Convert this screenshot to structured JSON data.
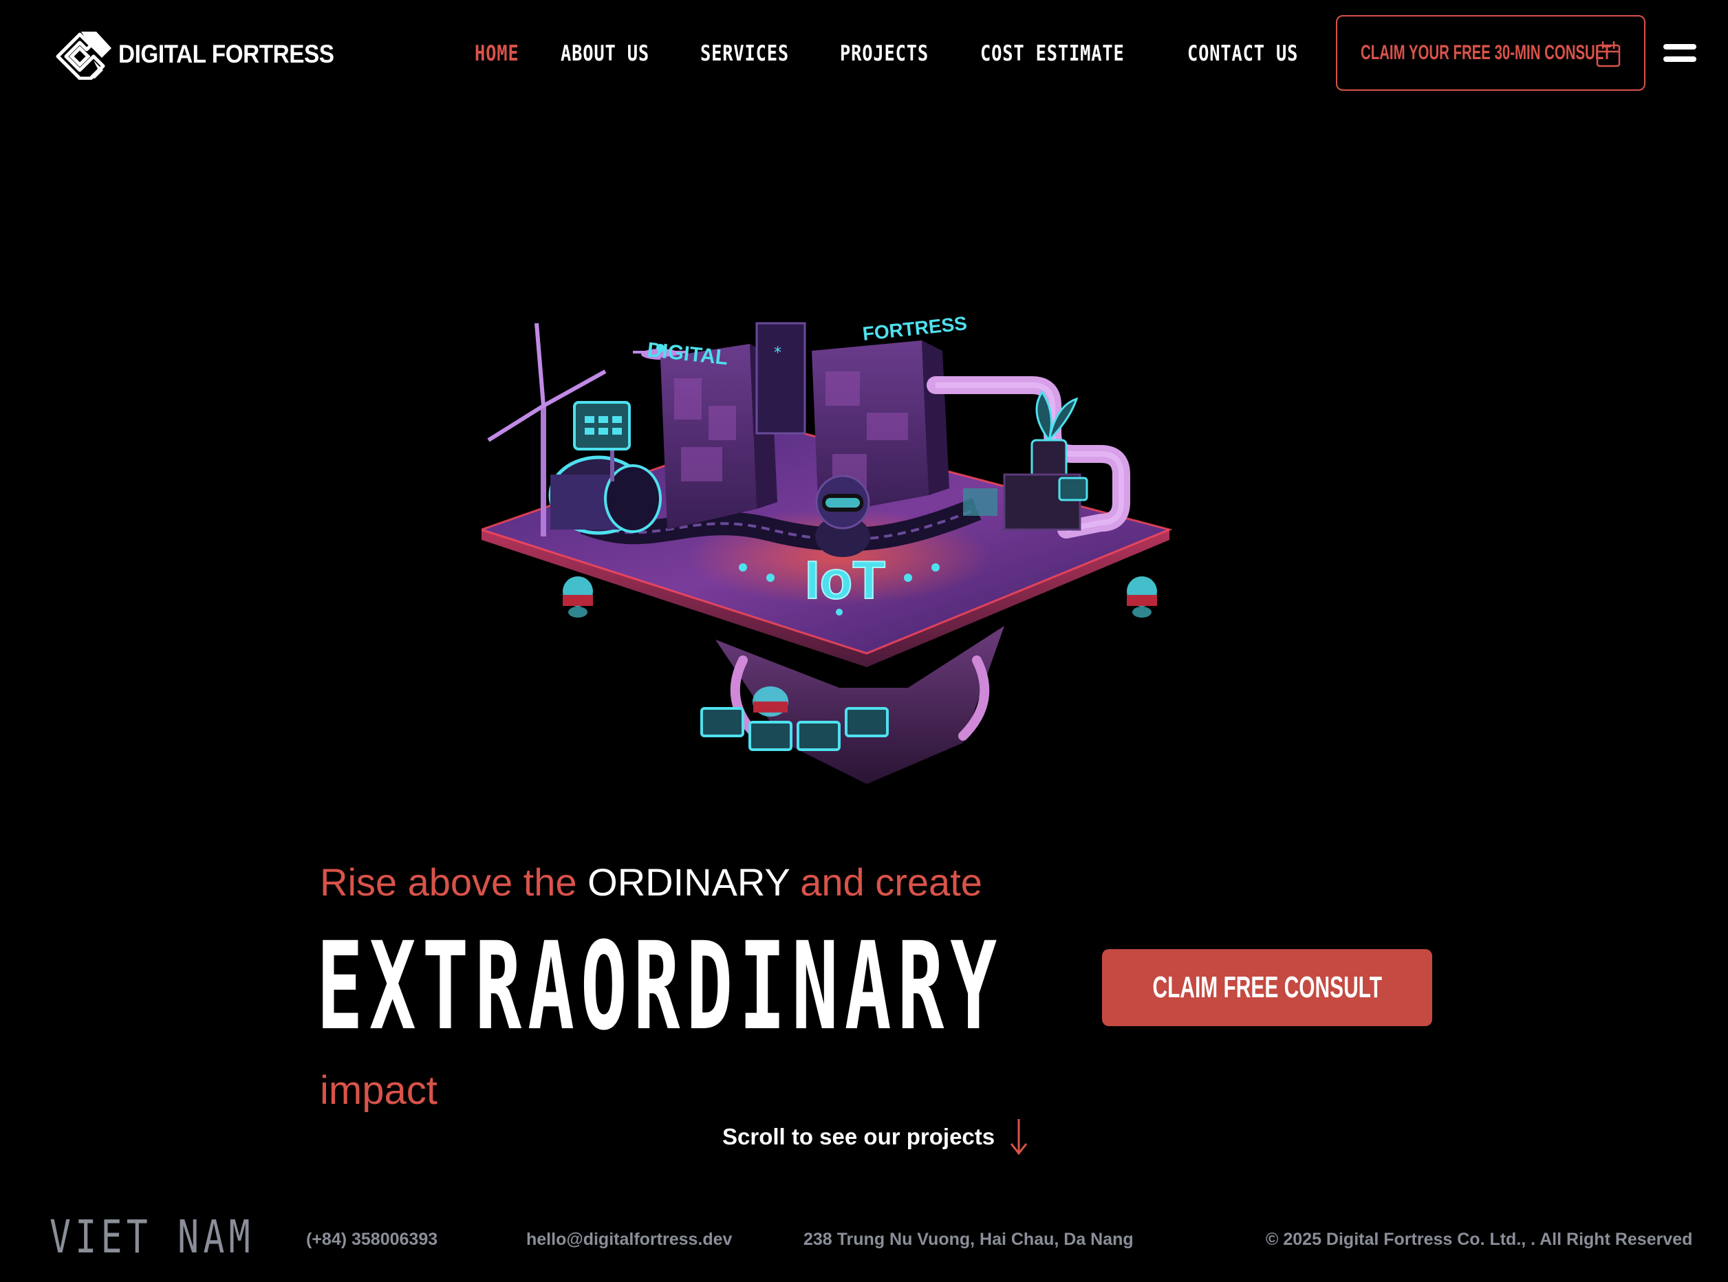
{
  "brand": {
    "name": "DIGITAL FORTRESS",
    "logo_icon": "fortress-logo-icon"
  },
  "nav": {
    "items": [
      {
        "label": "HOME",
        "active": true
      },
      {
        "label": "ABOUT US",
        "active": false
      },
      {
        "label": "SERVICES",
        "active": false
      },
      {
        "label": "PROJECTS",
        "active": false
      },
      {
        "label": "COST ESTIMATE",
        "active": false
      },
      {
        "label": "CONTACT US",
        "active": false
      }
    ]
  },
  "header": {
    "consult_label": "CLAIM YOUR FREE 30-MIN CONSULT",
    "consult_icon": "calendar-icon",
    "menu_icon": "hamburger-menu-icon"
  },
  "hero": {
    "art_labels": {
      "left_sign": "DIGITAL",
      "right_sign": "FORTRESS",
      "center_sign": "IoT"
    },
    "tagline": {
      "part1": "Rise above the ",
      "part2": "ORDINARY",
      "part3": " and create"
    },
    "headline": "EXTRAORDINARY",
    "impact": "impact",
    "cta_label": "CLAIM FREE CONSULT",
    "scroll_label": "Scroll to see our projects",
    "scroll_icon": "arrow-down-icon"
  },
  "footer": {
    "country": "VIET NAM",
    "phone": "(+84) 358006393",
    "email": "hello@digitalfortress.dev",
    "address": "238 Trung Nu Vuong, Hai Chau, Da Nang",
    "copyright": "© 2025 Digital Fortress Co. Ltd., . All Right Reserved"
  },
  "colors": {
    "background": "#000000",
    "accent": "#d9534a",
    "cta": "#c44a42",
    "muted": "#8a8e98",
    "neon_cyan": "#4fe0ee",
    "neon_purple": "#8a3fa6"
  }
}
